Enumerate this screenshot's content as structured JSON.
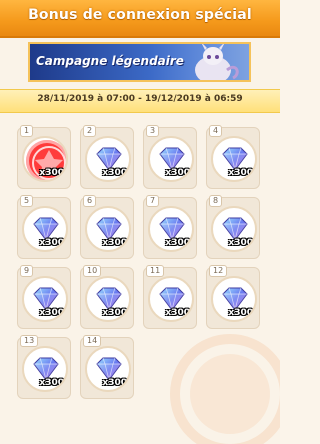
{
  "header": {
    "title": "Bonus de connexion spécial"
  },
  "banner": {
    "text": "Campagne légendaire"
  },
  "dates": {
    "range": "28/11/2019 à 07:00 - 19/12/2019 à 06:59"
  },
  "rewards": [
    {
      "day": "1",
      "qty": "x300",
      "item": "gem-icon",
      "collected": true
    },
    {
      "day": "2",
      "qty": "x300",
      "item": "gem-icon",
      "collected": false
    },
    {
      "day": "3",
      "qty": "x300",
      "item": "gem-icon",
      "collected": false
    },
    {
      "day": "4",
      "qty": "x300",
      "item": "gem-icon",
      "collected": false
    },
    {
      "day": "5",
      "qty": "x300",
      "item": "gem-icon",
      "collected": false
    },
    {
      "day": "6",
      "qty": "x300",
      "item": "gem-icon",
      "collected": false
    },
    {
      "day": "7",
      "qty": "x300",
      "item": "gem-icon",
      "collected": false
    },
    {
      "day": "8",
      "qty": "x300",
      "item": "gem-icon",
      "collected": false
    },
    {
      "day": "9",
      "qty": "x300",
      "item": "gem-icon",
      "collected": false
    },
    {
      "day": "10",
      "qty": "x300",
      "item": "gem-icon",
      "collected": false
    },
    {
      "day": "11",
      "qty": "x300",
      "item": "gem-icon",
      "collected": false
    },
    {
      "day": "12",
      "qty": "x300",
      "item": "gem-icon",
      "collected": false
    },
    {
      "day": "13",
      "qty": "x300",
      "item": "gem-icon",
      "collected": false
    },
    {
      "day": "14",
      "qty": "x300",
      "item": "gem-icon",
      "collected": false
    }
  ],
  "colors": {
    "header": "#f59a1c",
    "banner": "#1e3a8a",
    "date_bar": "#ffe07a",
    "stamp": "#ff3b3b"
  }
}
